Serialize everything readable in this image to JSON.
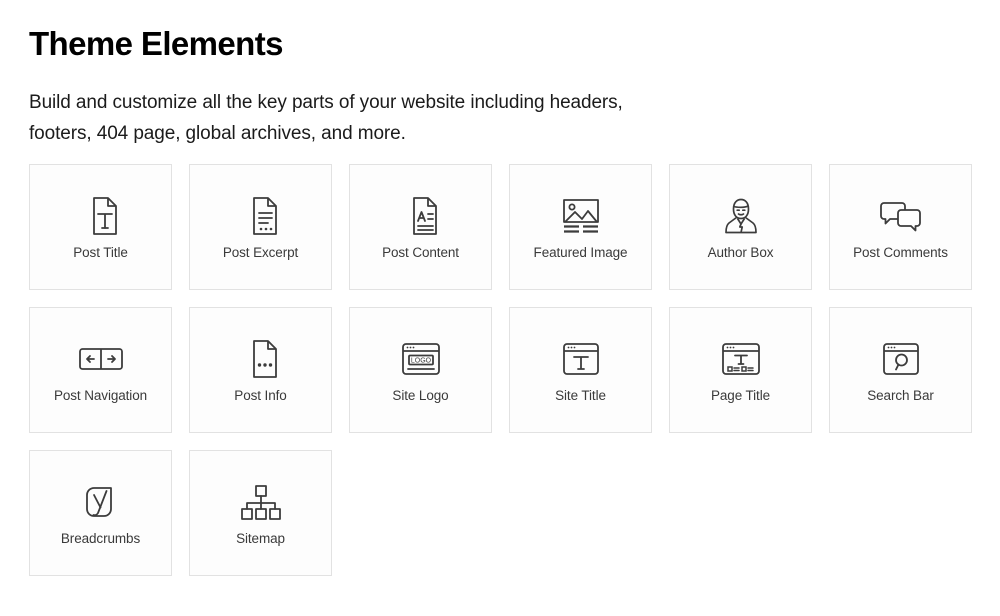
{
  "header": {
    "title": "Theme Elements",
    "description": "Build and customize all the key parts of your website including headers, footers, 404 page, global archives, and more."
  },
  "colors": {
    "background": "#ffffff",
    "card_background": "#fdfdfd",
    "card_border": "#e2e2e2",
    "title_text": "#000000",
    "label_text": "#3a3a3a",
    "icon_stroke": "#3c3c3c"
  },
  "elements": [
    {
      "label": "Post Title",
      "icon": "document-title-icon"
    },
    {
      "label": "Post Excerpt",
      "icon": "document-excerpt-icon"
    },
    {
      "label": "Post Content",
      "icon": "document-content-icon"
    },
    {
      "label": "Featured Image",
      "icon": "image-icon"
    },
    {
      "label": "Author Box",
      "icon": "author-person-icon"
    },
    {
      "label": "Post Comments",
      "icon": "speech-bubbles-icon"
    },
    {
      "label": "Post Navigation",
      "icon": "left-right-arrows-icon"
    },
    {
      "label": "Post Info",
      "icon": "document-dots-icon"
    },
    {
      "label": "Site Logo",
      "icon": "browser-logo-icon"
    },
    {
      "label": "Site Title",
      "icon": "browser-title-icon"
    },
    {
      "label": "Page Title",
      "icon": "browser-page-title-icon"
    },
    {
      "label": "Search Bar",
      "icon": "browser-search-icon"
    },
    {
      "label": "Breadcrumbs",
      "icon": "yoast-breadcrumbs-icon"
    },
    {
      "label": "Sitemap",
      "icon": "sitemap-tree-icon"
    }
  ]
}
